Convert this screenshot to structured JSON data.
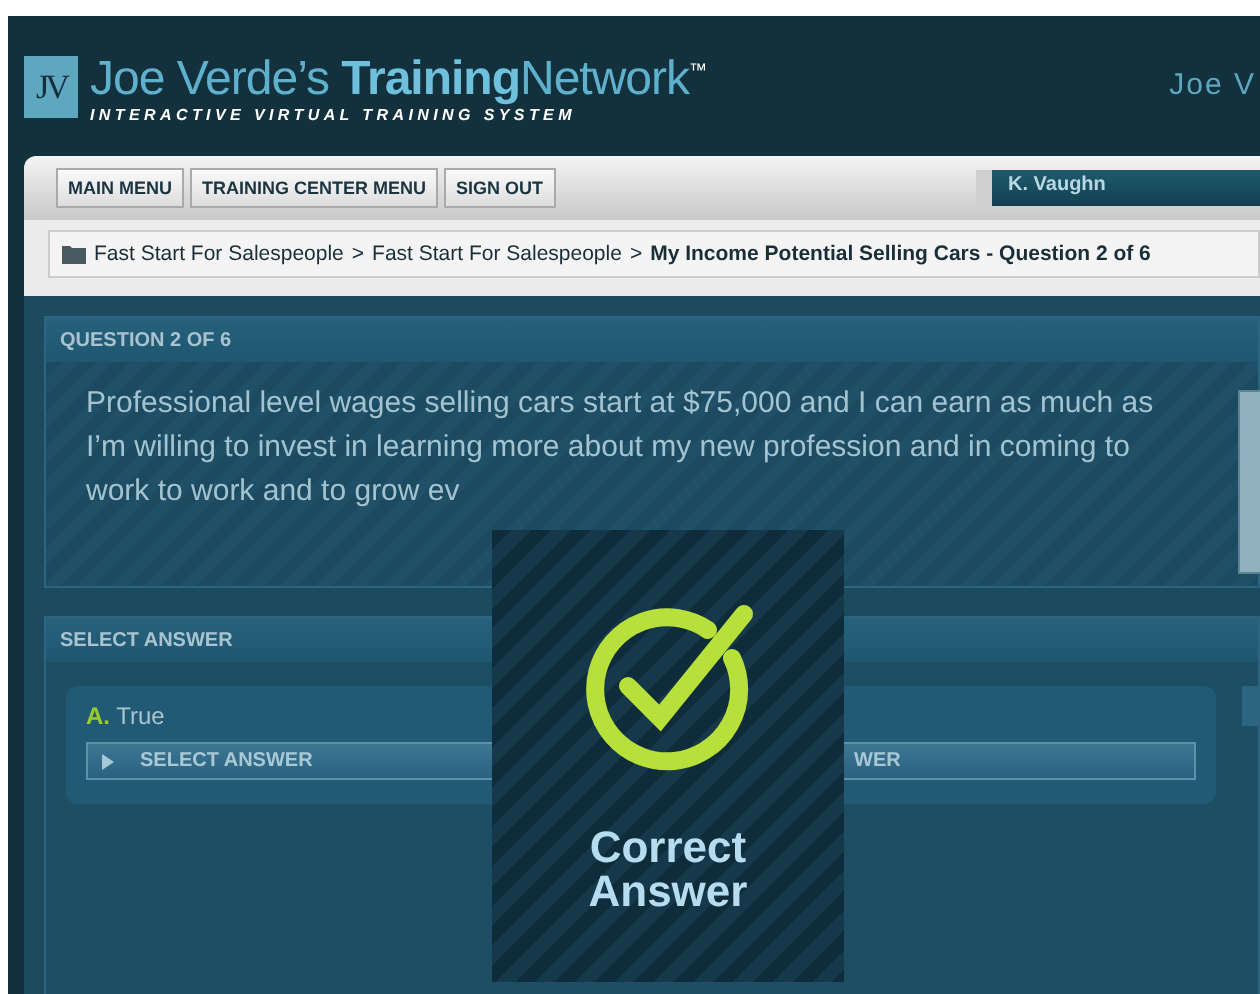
{
  "header": {
    "logo_letters": "JV",
    "title": "Joe Verde’s **Training**Network$^{™}$",
    "subtitle": "INTERACTIVE VIRTUAL TRAINING SYSTEM",
    "user_name": "Joe V"
  },
  "nav": {
    "buttons": [
      "MAIN MENU",
      "TRAINING CENTER MENU",
      "SIGN OUT"
    ],
    "user_field": "K. Vaughn"
  },
  "breadcrumb": {
    "items": [
      "Fast Start For Salespeople",
      "Fast Start For Salespeople",
      "My Income Potential Selling Cars - Question 2 of 6"
    ],
    "separator": ">"
  },
  "question": {
    "header": "QUESTION 2 OF 6",
    "text": "Professional level wages selling cars start at $75,000 and I can earn as much as I’m willing to invest in learning more about my new profession and in coming to work to work and to grow ev"
  },
  "answers": {
    "header": "SELECT ANSWER",
    "options": [
      {
        "letter": "A.",
        "label": "True",
        "button": "SELECT ANSWER",
        "button_tail": "WER"
      }
    ]
  },
  "overlay": {
    "lines": [
      "Correct",
      "Answer"
    ]
  }
}
